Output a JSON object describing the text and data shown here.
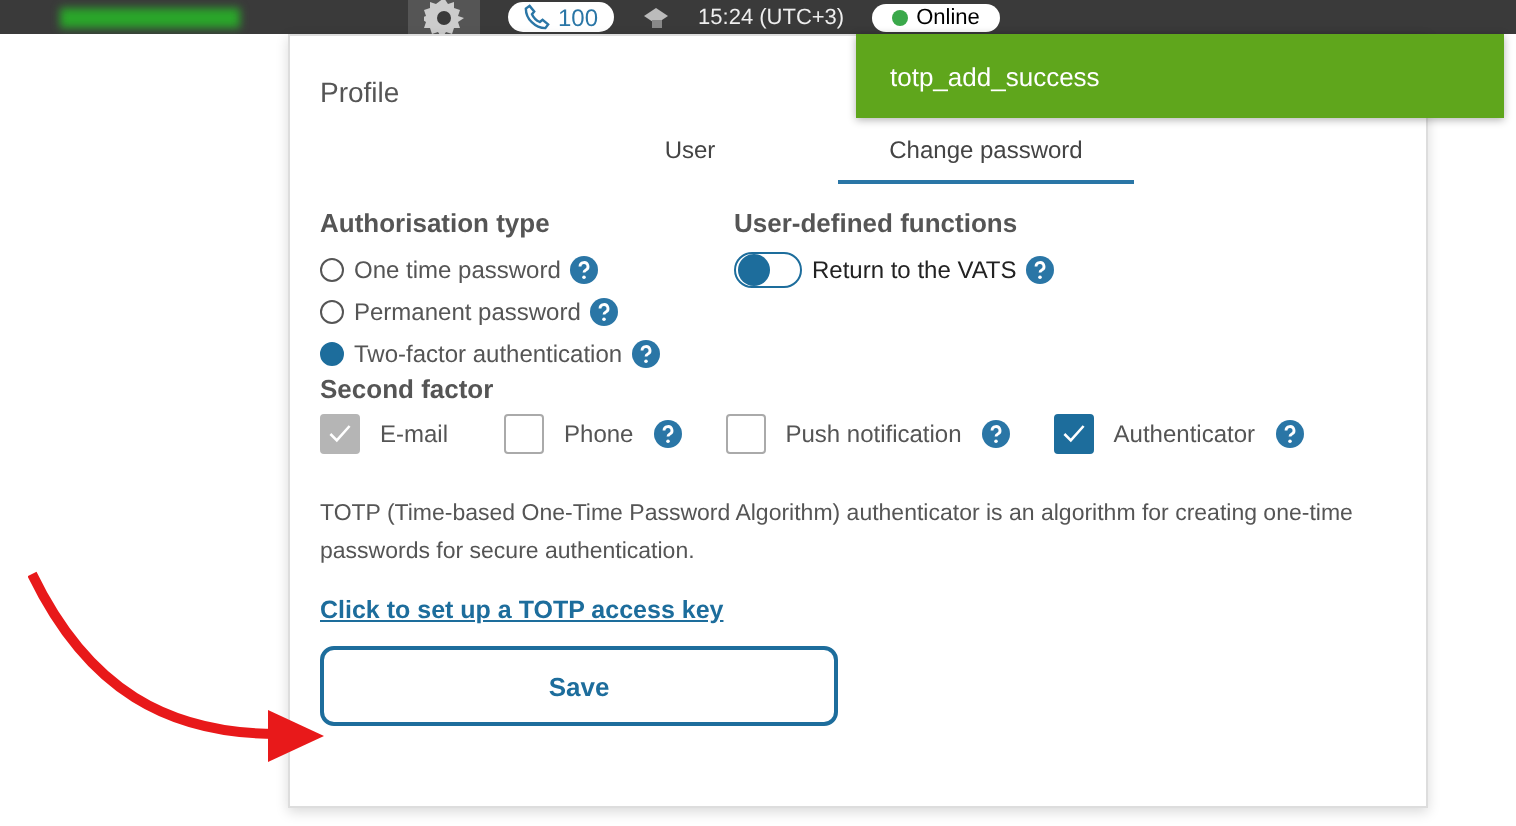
{
  "top_bar": {
    "phone_count": "100",
    "time": "15:24 (UTC+3)",
    "status": "Online"
  },
  "toast": {
    "text": "totp_add_success"
  },
  "profile": {
    "title": "Profile",
    "tabs": [
      {
        "label": "User",
        "selected": false
      },
      {
        "label": "Change password",
        "selected": true
      }
    ],
    "authorisation": {
      "heading": "Authorisation type",
      "options": [
        {
          "label": "One time password",
          "selected": false
        },
        {
          "label": "Permanent password",
          "selected": false
        },
        {
          "label": "Two-factor authentication",
          "selected": true
        }
      ]
    },
    "functions": {
      "heading": "User-defined functions",
      "toggles": [
        {
          "label": "Return to the VATS",
          "on": false
        }
      ]
    },
    "second_factor": {
      "heading": "Second factor",
      "options": [
        {
          "label": "E-mail",
          "checked": true,
          "disabled": true,
          "help": false
        },
        {
          "label": "Phone",
          "checked": false,
          "disabled": false,
          "help": true
        },
        {
          "label": "Push notification",
          "checked": false,
          "disabled": false,
          "help": true
        },
        {
          "label": "Authenticator",
          "checked": true,
          "disabled": false,
          "help": true
        }
      ]
    },
    "description": "TOTP (Time-based One-Time Password Algorithm) authenticator is an algorithm for creating one-time passwords for secure authentication.",
    "link": "Click to set up a TOTP access key",
    "save_button": "Save"
  }
}
